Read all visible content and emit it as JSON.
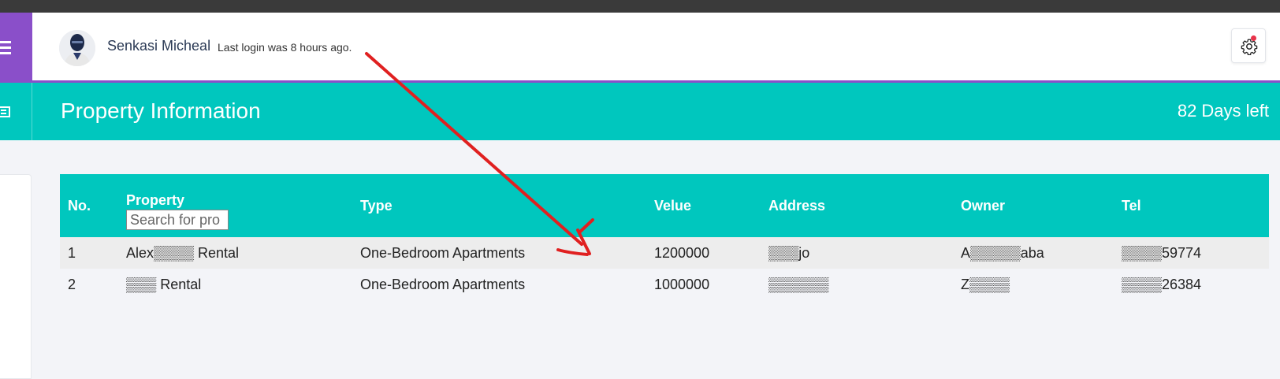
{
  "header": {
    "user_name": "Senkasi Micheal",
    "last_login": "Last login was 8 hours ago."
  },
  "title_bar": {
    "title": "Property Information",
    "days_left": "82 Days left"
  },
  "table": {
    "columns": {
      "no": "No.",
      "property": "Property",
      "type": "Type",
      "value": "Velue",
      "address": "Address",
      "owner": "Owner",
      "tel": "Tel"
    },
    "search_placeholder": "Search for pro",
    "rows": [
      {
        "no": "1",
        "property": "Alex▒▒▒▒ Rental",
        "type": "One-Bedroom Apartments",
        "value": "1200000",
        "address": "▒▒▒jo",
        "owner": "A▒▒▒▒▒aba",
        "tel": "▒▒▒▒59774"
      },
      {
        "no": "2",
        "property": "▒▒▒ Rental",
        "type": "One-Bedroom Apartments",
        "value": "1000000",
        "address": "▒▒▒▒▒▒",
        "owner": "Z▒▒▒▒",
        "tel": "▒▒▒▒26384"
      }
    ]
  },
  "colors": {
    "accent_teal": "#00c7be",
    "menu_purple": "#8a4fc9",
    "notification_red": "#e8334a",
    "annotation_red": "#e02020"
  }
}
